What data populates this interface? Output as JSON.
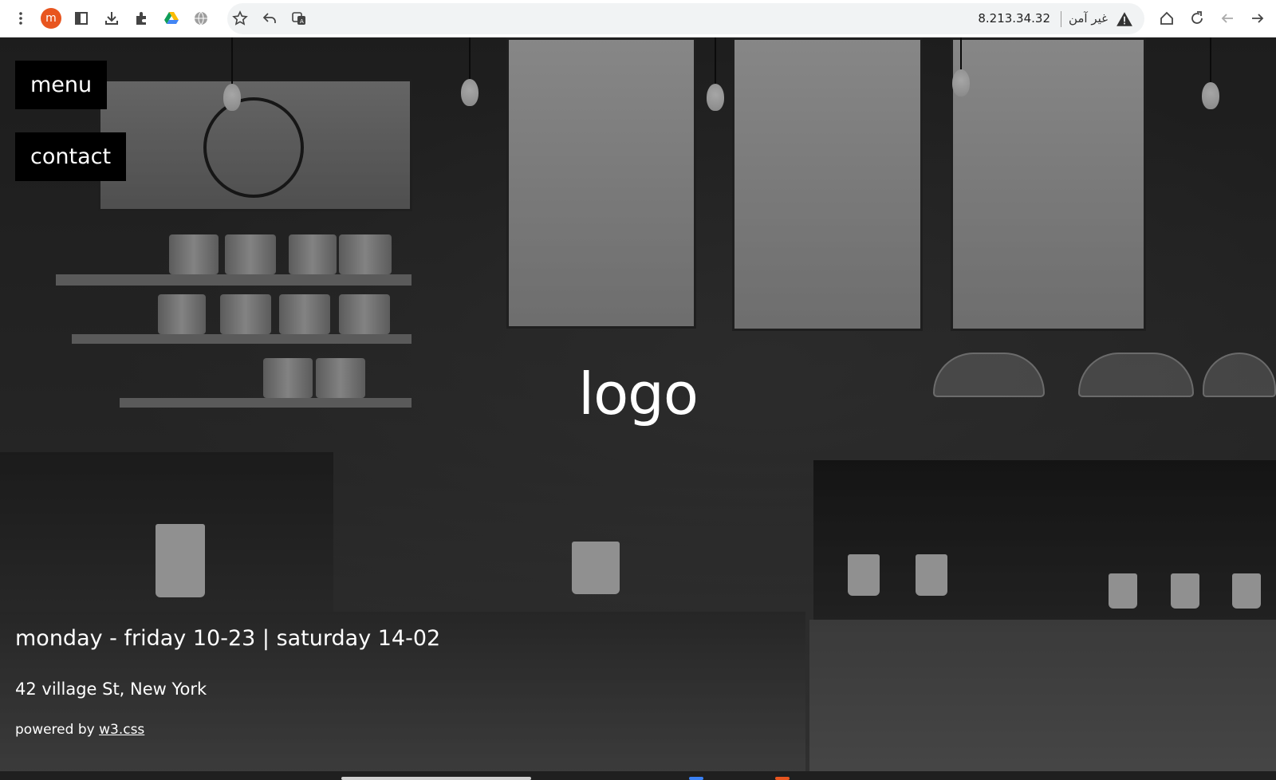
{
  "browser": {
    "address_url": "8.213.34.32",
    "security_label": "غير آمن",
    "profile_initial": "m",
    "profile_color": "#e8551f",
    "icons": [
      "more-vert-icon",
      "profile-avatar",
      "sidebar-icon",
      "download-icon",
      "extensions-icon",
      "google-drive-icon",
      "globe-icon",
      "star-icon",
      "share-icon",
      "translate-icon",
      "warning-icon",
      "home-icon",
      "reload-icon",
      "back-icon",
      "forward-icon"
    ]
  },
  "page": {
    "nav": {
      "menu_label": "menu",
      "contact_label": "contact"
    },
    "logo_text": "logo",
    "hours_text": "monday - friday 10-23 | saturday 14-02",
    "address_text": "42 village St, New York",
    "powered_prefix": "powered by ",
    "powered_link": "w3.css"
  }
}
